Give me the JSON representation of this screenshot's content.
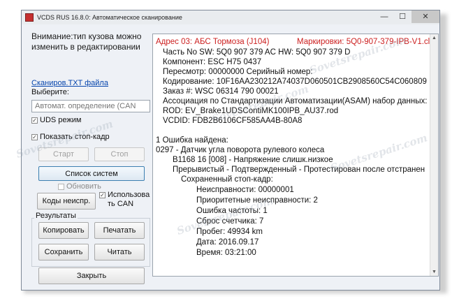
{
  "window": {
    "title": "VCDS RUS 16.8.0:  Автоматическое сканирование",
    "minimize_glyph": "—",
    "maximize_glyph": "☐",
    "close_glyph": "✕"
  },
  "left": {
    "warning_line1": "Внимание:тип кузова можно",
    "warning_line2": "изменить в редактировании",
    "scan_link": "Сканиров.TXT файла",
    "choose_label": "Выберите:",
    "combo_value": "Автомат. определение (CAN",
    "uds_label": "UDS режим",
    "freeze_label": "Показать стоп-кадр",
    "start_button": "Старт",
    "stop_button": "Стоп",
    "systems_button": "Список систем",
    "refresh_label": "Обновить",
    "fault_codes_button": "Коды неиспр.",
    "use_can_line1": "Использова",
    "use_can_line2": "ть CAN",
    "results_label": "Результаты",
    "copy_button": "Копировать",
    "print_button": "Печатать",
    "save_button": "Сохранить",
    "read_button": "Читать",
    "close_button": "Закрыть"
  },
  "report": {
    "address": "Адрес 03: АБС Тормоза (J104)",
    "marking": "Маркировки: 5Q0-907-379-IPB-V1.clb",
    "lines": [
      "Часть No SW: 5Q0 907 379 AC    HW: 5Q0 907 379 D",
      "Компонент: ESC           H75 0437",
      "Пересмотр: 00000000    Серийный номер:",
      "Кодирование: 10F16AA230212A74037D060501CB2908560C54C060809",
      "Заказ #: WSC 06314 790 00021",
      "Ассоциация по Стандартизации Автоматизации(ASAM) набор данных:",
      "ROD: EV_Brake1UDSContiMK100IPB_AU37.rod",
      "VCDID: FDB2B6106CF585AA4B-80A8"
    ],
    "fault_found": "1 Ошибка найдена:",
    "fault_code": "0297 - Датчик угла поворота рулевого колеса",
    "fault_detail": "B1168 16 [008] - Напряжение слишк.низкое",
    "fault_status": "Прерывистый - Подтвержденный - Протестирован после отстранен",
    "freeze_title": "Сохраненный стоп-кадр:",
    "freeze": [
      "Неисправности: 00000001",
      "Приоритетные неисправности: 2",
      "Ошибка частоты: 1",
      "Сброс счетчика: 7",
      "Пробег: 49934 km",
      "Дата: 2016.09.17",
      "Время: 03:21:00"
    ]
  },
  "watermark": "Sovetsrepair.com",
  "colors": {
    "address_red": "#cc1f1f",
    "link_blue": "#0645ad"
  }
}
